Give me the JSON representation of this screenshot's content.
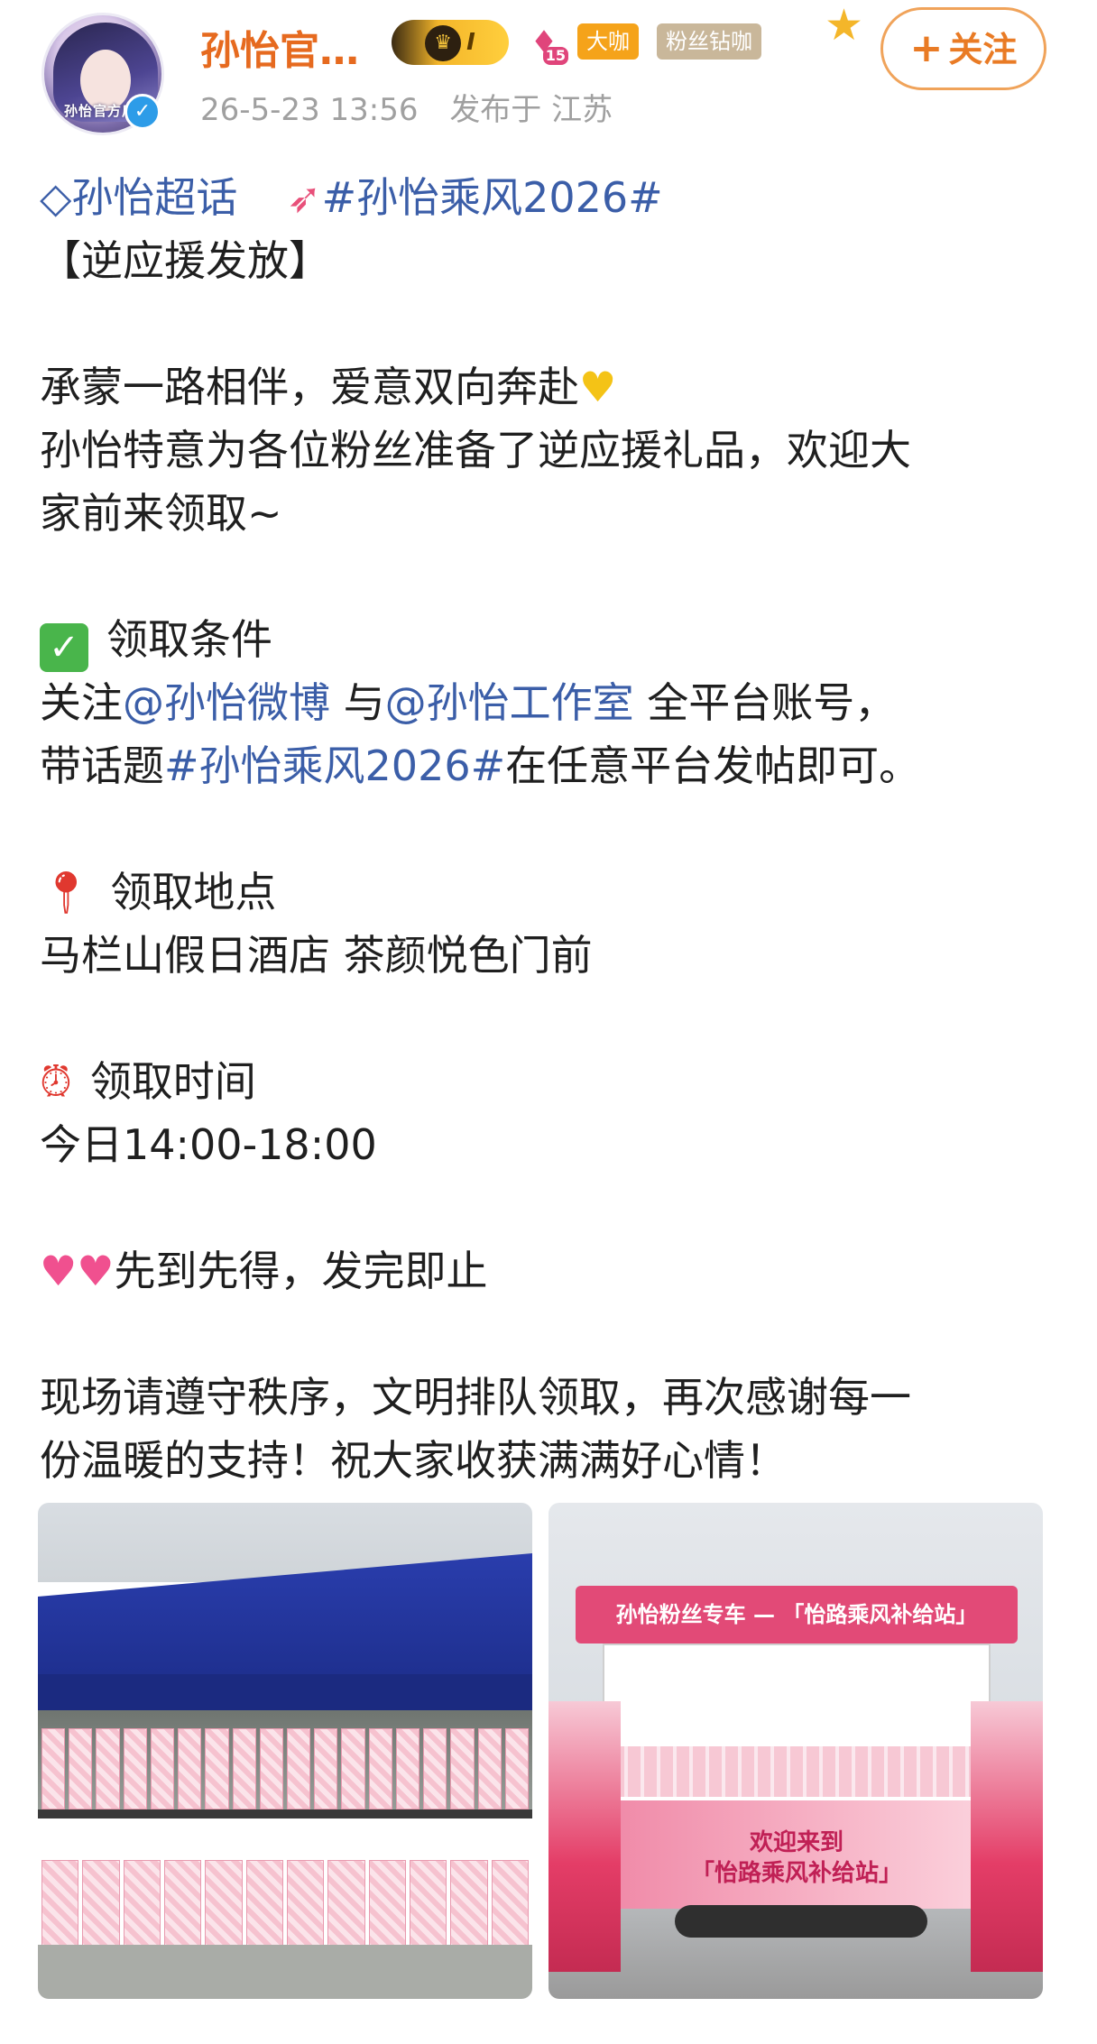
{
  "header": {
    "username": "孙怡官…",
    "avatar_caption": "孙怡官方后援",
    "verified_icon": "check-icon",
    "badges": {
      "crown_text": "I",
      "level": "15",
      "daka": "大咖",
      "fans": "粉丝钻咖"
    },
    "follow_label": "关注",
    "date": "26-5-23 13:56",
    "location": "发布于 江苏"
  },
  "post": {
    "topic_super": "孙怡超话",
    "topic_hash": "#孙怡乘风2026#",
    "title": "【逆应援发放】",
    "para1_line1": "承蒙一路相伴，爱意双向奔赴",
    "para1_line2": "孙怡特意为各位粉丝准备了逆应援礼品，欢迎大",
    "para1_line3": "家前来领取~",
    "cond_heading": "领取条件",
    "cond_prefix": "关注",
    "cond_mention1": "@孙怡微博",
    "cond_mid": "与",
    "cond_mention2": "@孙怡工作室",
    "cond_suffix": "全平台账号，",
    "cond2_prefix": "带话题",
    "cond2_hash": "#孙怡乘风2026#",
    "cond2_suffix": "在任意平台发帖即可。",
    "place_heading": "领取地点",
    "place": "马栏山假日酒店 茶颜悦色门前",
    "time_heading": "领取时间",
    "time": "今日14:00-18:00",
    "first_come": "先到先得，发完即止",
    "closing_line1": "现场请遵守秩序，文明排队领取，再次感谢每一",
    "closing_line2": "份温暖的支持！祝大家收获满满好心情！"
  },
  "photos": {
    "right_banner": "孙怡粉丝专车 — 「怡路乘风补给站」",
    "right_panel_line1": "欢迎来到",
    "right_panel_line2": "「怡路乘风补给站」"
  },
  "colors": {
    "username": "#e66a1f",
    "link": "#3b5ea8",
    "meta": "#a0a0a0",
    "follow_border": "#f0a35a"
  }
}
